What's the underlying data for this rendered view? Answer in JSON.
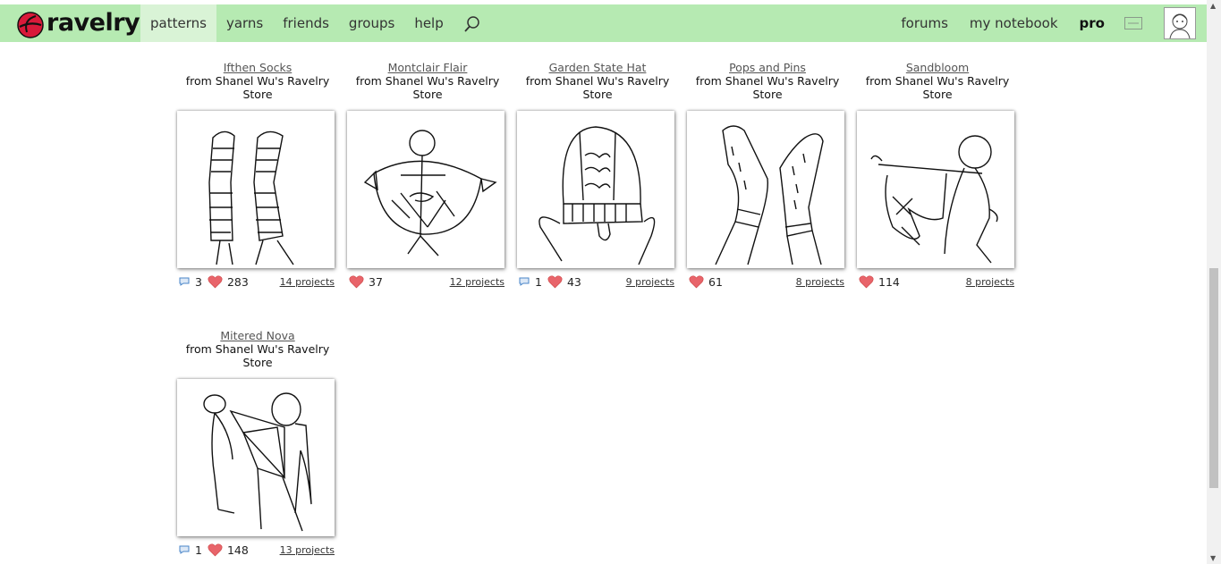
{
  "header": {
    "logo_text": "ravelry",
    "nav_left": [
      "patterns",
      "yarns",
      "friends",
      "groups",
      "help"
    ],
    "active_nav": "patterns",
    "nav_right": [
      "forums",
      "my notebook",
      "pro"
    ],
    "icons": [
      "search-icon",
      "mail-icon",
      "avatar"
    ]
  },
  "patterns": [
    {
      "title": "Ifthen Socks",
      "from": "from Shanel Wu's Ravelry Store",
      "comments": "3",
      "likes": "283",
      "projects": "14 projects"
    },
    {
      "title": "Montclair Flair",
      "from": "from Shanel Wu's Ravelry Store",
      "comments": "",
      "likes": "37",
      "projects": "12 projects"
    },
    {
      "title": "Garden State Hat",
      "from": "from Shanel Wu's Ravelry Store",
      "comments": "1",
      "likes": "43",
      "projects": "9 projects"
    },
    {
      "title": "Pops and Pins",
      "from": "from Shanel Wu's Ravelry Store",
      "comments": "",
      "likes": "61",
      "projects": "8 projects"
    },
    {
      "title": "Sandbloom",
      "from": "from Shanel Wu's Ravelry Store",
      "comments": "",
      "likes": "114",
      "projects": "8 projects"
    },
    {
      "title": "Mitered Nova",
      "from": "from Shanel Wu's Ravelry Store",
      "comments": "1",
      "likes": "148",
      "projects": "13 projects"
    }
  ],
  "colors": {
    "header_bg": "#b6eab2",
    "active_tab": "#d9f3d6",
    "logo_red": "#d91a3a",
    "heart": "#e8646a",
    "comment": "#4a86c8"
  }
}
